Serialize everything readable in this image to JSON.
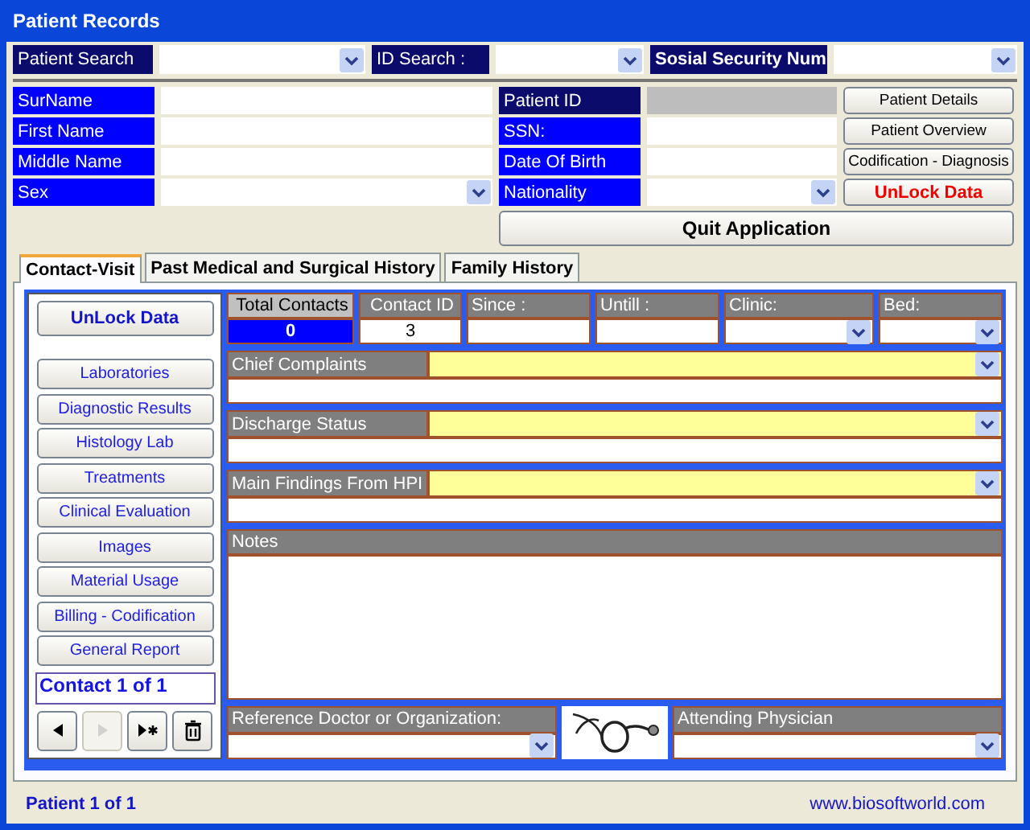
{
  "window": {
    "title": "Patient Records"
  },
  "search": [
    {
      "label": "Patient  Search",
      "bold": false
    },
    {
      "label": "ID Search :",
      "bold": false
    },
    {
      "label": "Sosial Security Num",
      "bold": true
    }
  ],
  "fields_left": [
    {
      "label": "SurName",
      "kind": "text",
      "disabled": false
    },
    {
      "label": "First Name",
      "kind": "text",
      "disabled": false
    },
    {
      "label": "Middle Name",
      "kind": "text",
      "disabled": false
    },
    {
      "label": "Sex",
      "kind": "combo",
      "disabled": false
    }
  ],
  "fields_right": [
    {
      "label": "Patient ID",
      "kind": "text",
      "disabled": true
    },
    {
      "label": "SSN:",
      "kind": "text",
      "disabled": false
    },
    {
      "label": "Date Of Birth",
      "kind": "text",
      "disabled": false
    },
    {
      "label": "Nationality",
      "kind": "combo",
      "disabled": false
    }
  ],
  "buttons": [
    {
      "label": "Patient Details",
      "kind": "normal"
    },
    {
      "label": "Patient Overview",
      "kind": "normal"
    },
    {
      "label": "Codification - Diagnosis",
      "kind": "normal"
    },
    {
      "label": "UnLock Data",
      "kind": "warning"
    }
  ],
  "quit_button": "Quit Application",
  "tabs": [
    {
      "label": "Contact-Visit",
      "selected": true
    },
    {
      "label": "Past Medical and Surgical History",
      "selected": false
    },
    {
      "label": "Family History",
      "selected": false
    }
  ],
  "sidebar": {
    "unlock_button": "UnLock Data",
    "items": [
      "Laboratories",
      "Diagnostic Results",
      "Histology Lab",
      "Treatments",
      "Clinical Evaluation",
      "Images",
      "Material Usage",
      "Billing - Codification",
      "General Report"
    ],
    "counter": "Contact 1 of 1",
    "record_nav": [
      {
        "kind": "previous",
        "disabled": false
      },
      {
        "kind": "next",
        "disabled": true
      },
      {
        "kind": "new",
        "disabled": false
      },
      {
        "kind": "delete",
        "disabled": false
      }
    ]
  },
  "header_cells": [
    {
      "label": "Total Contacts",
      "value": "0",
      "kind": "total"
    },
    {
      "label": "Contact ID",
      "value": "3",
      "kind": "text"
    },
    {
      "label": "Since :",
      "kind": "text"
    },
    {
      "label": "Untill :",
      "kind": "text"
    },
    {
      "label": "Clinic:",
      "kind": "combo"
    },
    {
      "label": "Bed:",
      "kind": "combo"
    }
  ],
  "sections": [
    {
      "label": "Chief Complaints"
    },
    {
      "label": "Discharge Status"
    },
    {
      "label": "Main Findings From HPI"
    }
  ],
  "notes": {
    "label": "Notes"
  },
  "reference": {
    "label": "Reference Doctor or Organization:"
  },
  "attending": {
    "label": "Attending Physician"
  },
  "status_bar": {
    "left": "Patient  1 of 1",
    "right": "www.biosoftworld.com"
  }
}
